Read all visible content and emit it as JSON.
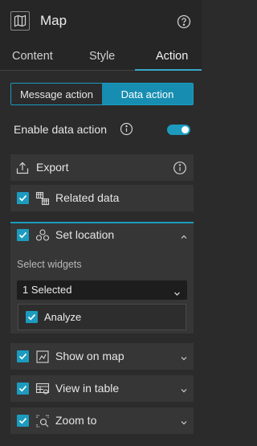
{
  "header": {
    "title": "Map",
    "icon": "map-icon",
    "help_icon": "help-icon"
  },
  "tabs": [
    {
      "label": "Content",
      "active": false
    },
    {
      "label": "Style",
      "active": false
    },
    {
      "label": "Action",
      "active": true
    }
  ],
  "action_type": {
    "options": [
      "Message action",
      "Data action"
    ],
    "selected": "Data action"
  },
  "enable_data_action": {
    "label": "Enable data action",
    "enabled": true
  },
  "actions": [
    {
      "label": "Export",
      "icon": "export-icon",
      "checkbox": false,
      "info": true
    },
    {
      "label": "Related data",
      "icon": "related-data-icon",
      "checked": true
    },
    {
      "label": "Set location",
      "icon": "set-location-icon",
      "checked": true,
      "expanded": true
    },
    {
      "label": "Show on map",
      "icon": "show-on-map-icon",
      "checked": true
    },
    {
      "label": "View in table",
      "icon": "view-in-table-icon",
      "checked": true
    },
    {
      "label": "Zoom to",
      "icon": "zoom-to-icon",
      "checked": true
    }
  ],
  "set_location": {
    "select_widgets_label": "Select widgets",
    "selected_value": "1 Selected",
    "options": [
      {
        "label": "Analyze",
        "checked": true
      }
    ]
  },
  "colors": {
    "accent": "#1c9bbf",
    "panel": "#2b2b2b",
    "row": "#363636"
  }
}
